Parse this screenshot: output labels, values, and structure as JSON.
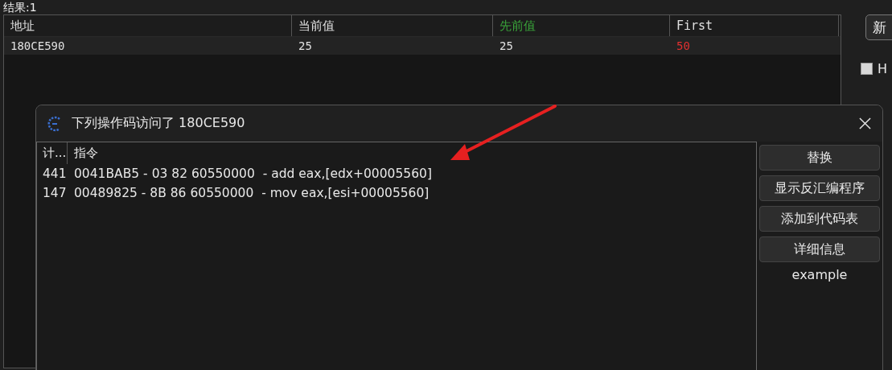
{
  "results_label": "结果:1",
  "table": {
    "columns": [
      {
        "label": "地址",
        "color": "#e0e0e0"
      },
      {
        "label": "当前值",
        "color": "#e0e0e0"
      },
      {
        "label": "先前值",
        "color": "#3aa43a"
      },
      {
        "label": "First",
        "color": "#e0e0e0"
      }
    ],
    "rows": [
      {
        "cells": [
          {
            "text": "180CE590",
            "color": "#e0e0e0"
          },
          {
            "text": "25",
            "color": "#e0e0e0"
          },
          {
            "text": "25",
            "color": "#e0e0e0"
          },
          {
            "text": "50",
            "color": "#e03030"
          }
        ]
      }
    ]
  },
  "side_panel": {
    "button": "新",
    "checkbox": {
      "label": "H",
      "checked": false
    }
  },
  "dialog": {
    "title": "下列操作码访问了 180CE590",
    "list": {
      "columns": [
        "计...",
        "指令"
      ],
      "rows": [
        {
          "count": "441",
          "instruction": "0041BAB5 - 03 82 60550000  - add eax,[edx+00005560]"
        },
        {
          "count": "147",
          "instruction": "00489825 - 8B 86 60550000  - mov eax,[esi+00005560]"
        }
      ]
    },
    "buttons": [
      "替换",
      "显示反汇编程序",
      "添加到代码表",
      "详细信息"
    ],
    "note": "example"
  }
}
